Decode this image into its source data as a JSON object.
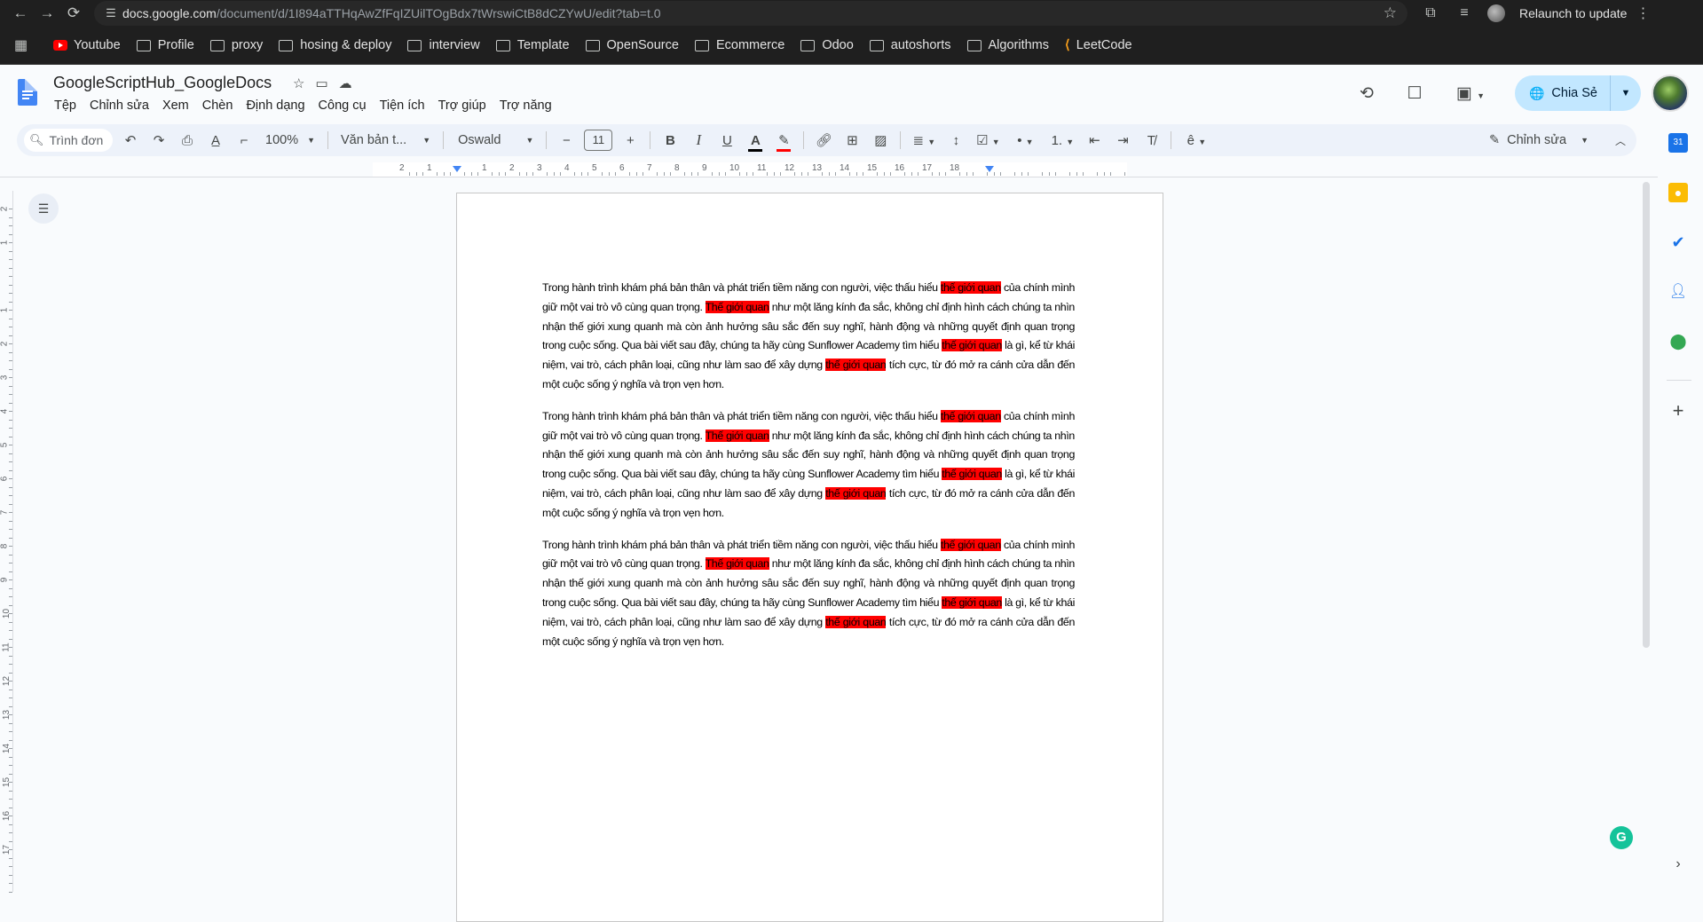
{
  "browser": {
    "url_host": "docs.google.com",
    "url_path": "/document/d/1I894aTTHqAwZfFqIZUilTOgBdx7tWrswiCtB8dCZYwU/edit?tab=t.0",
    "relaunch_label": "Relaunch to update"
  },
  "bookmarks": [
    {
      "label": "Youtube",
      "icon": "youtube-icon"
    },
    {
      "label": "Profile",
      "icon": "folder-icon"
    },
    {
      "label": "proxy",
      "icon": "folder-icon"
    },
    {
      "label": "hosing & deploy",
      "icon": "folder-icon"
    },
    {
      "label": "interview",
      "icon": "folder-icon"
    },
    {
      "label": "Template",
      "icon": "folder-icon"
    },
    {
      "label": "OpenSource",
      "icon": "folder-icon"
    },
    {
      "label": "Ecommerce",
      "icon": "folder-icon"
    },
    {
      "label": "Odoo",
      "icon": "folder-icon"
    },
    {
      "label": "autoshorts",
      "icon": "folder-icon"
    },
    {
      "label": "Algorithms",
      "icon": "folder-icon"
    },
    {
      "label": "LeetCode",
      "icon": "leetcode-icon"
    }
  ],
  "doc": {
    "title": "GoogleScriptHub_GoogleDocs",
    "menu": [
      "Tệp",
      "Chỉnh sửa",
      "Xem",
      "Chèn",
      "Định dạng",
      "Công cụ",
      "Tiện ích",
      "Trợ giúp",
      "Trợ năng"
    ],
    "share_label": "Chia Sẻ"
  },
  "toolbar": {
    "search_placeholder": "Trình đơn",
    "zoom": "100%",
    "style": "Văn bản t...",
    "font": "Oswald",
    "font_size": "11",
    "editing_mode": "Chỉnh sửa"
  },
  "colors": {
    "highlight": "#ff0000",
    "share_bg": "#c2e7ff",
    "accent": "#4285f4"
  },
  "content": {
    "paragraphs": [
      [
        {
          "t": "Trong hành trình khám phá bản thân và phát triển tiềm năng con người, việc thấu hiểu ",
          "hl": false
        },
        {
          "t": "thế giới quan",
          "hl": true
        },
        {
          "t": " của chính mình giữ một vai trò vô cùng quan trọng. ",
          "hl": false
        },
        {
          "t": "Thế giới quan",
          "hl": true
        },
        {
          "t": " như một lăng kính đa sắc, không chỉ định hình cách chúng ta nhìn nhận thế giới xung quanh mà còn ảnh hưởng sâu sắc đến suy nghĩ, hành động và những quyết định quan trọng trong cuộc sống. Qua bài viết sau đây, chúng ta hãy cùng Sunflower Academy tìm hiểu ",
          "hl": false
        },
        {
          "t": "thế giới quan",
          "hl": true
        },
        {
          "t": " là gì, kể từ khái niệm, vai trò, cách phân loại, cũng như làm sao để xây dựng ",
          "hl": false
        },
        {
          "t": "thế giới quan",
          "hl": true
        },
        {
          "t": " tích cực, từ đó mở ra cánh cửa dẫn đến một cuộc sống ý nghĩa và trọn vẹn hơn.",
          "hl": false
        }
      ],
      [
        {
          "t": "Trong hành trình khám phá bản thân và phát triển tiềm năng con người, việc thấu hiểu ",
          "hl": false
        },
        {
          "t": "thế giới quan",
          "hl": true
        },
        {
          "t": " của chính mình giữ một vai trò vô cùng quan trọng. ",
          "hl": false
        },
        {
          "t": "Thế giới quan",
          "hl": true
        },
        {
          "t": " như một lăng kính đa sắc, không chỉ định hình cách chúng ta nhìn nhận thế giới xung quanh mà còn ảnh hưởng sâu sắc đến suy nghĩ, hành động và những quyết định quan trọng trong cuộc sống. Qua bài viết sau đây, chúng ta hãy cùng Sunflower Academy tìm hiểu ",
          "hl": false
        },
        {
          "t": "thế giới quan",
          "hl": true
        },
        {
          "t": " là gì, kể từ khái niệm, vai trò, cách phân loại, cũng như làm sao để xây dựng ",
          "hl": false
        },
        {
          "t": "thế giới quan",
          "hl": true
        },
        {
          "t": " tích cực, từ đó mở ra cánh cửa dẫn đến một cuộc sống ý nghĩa và trọn vẹn hơn.",
          "hl": false
        }
      ],
      [
        {
          "t": "Trong hành trình khám phá bản thân và phát triển tiềm năng con người, việc thấu hiểu ",
          "hl": false
        },
        {
          "t": "thế giới quan",
          "hl": true
        },
        {
          "t": " của chính mình giữ một vai trò vô cùng quan trọng. ",
          "hl": false
        },
        {
          "t": "Thế giới quan",
          "hl": true
        },
        {
          "t": " như một lăng kính đa sắc, không chỉ định hình cách chúng ta nhìn nhận thế giới xung quanh mà còn ảnh hưởng sâu sắc đến suy nghĩ, hành động và những quyết định quan trọng trong cuộc sống. Qua bài viết sau đây, chúng ta hãy cùng Sunflower Academy tìm hiểu ",
          "hl": false
        },
        {
          "t": "thế giới quan",
          "hl": true
        },
        {
          "t": " là gì, kể từ khái niệm, vai trò, cách phân loại, cũng như làm sao để xây dựng ",
          "hl": false
        },
        {
          "t": "thế giới quan",
          "hl": true
        },
        {
          "t": " tích cực, từ đó mở ra cánh cửa dẫn đến một cuộc sống ý nghĩa và trọn vẹn hơn.",
          "hl": false
        }
      ]
    ]
  },
  "ruler": {
    "h_labels": [
      "2",
      "1",
      "1",
      "2",
      "3",
      "4",
      "5",
      "6",
      "7",
      "8",
      "9",
      "10",
      "11",
      "12",
      "13",
      "14",
      "15",
      "16",
      "17",
      "18"
    ],
    "v_labels": [
      "2",
      "1",
      "1",
      "2",
      "3",
      "4",
      "5",
      "6",
      "7",
      "8",
      "9",
      "10",
      "11",
      "12",
      "13",
      "14",
      "15",
      "16",
      "17"
    ]
  }
}
